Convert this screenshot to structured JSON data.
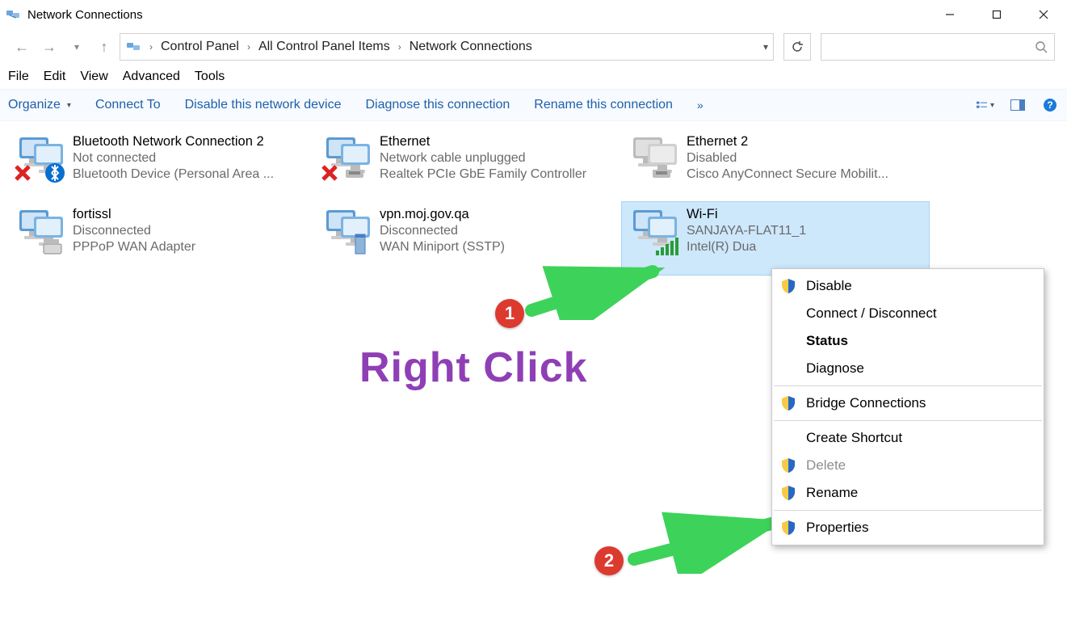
{
  "window": {
    "title": "Network Connections"
  },
  "breadcrumb": {
    "segments": [
      "Control Panel",
      "All Control Panel Items",
      "Network Connections"
    ]
  },
  "menu": {
    "items": [
      "File",
      "Edit",
      "View",
      "Advanced",
      "Tools"
    ]
  },
  "command_bar": {
    "organize": "Organize",
    "actions": [
      "Connect To",
      "Disable this network device",
      "Diagnose this connection",
      "Rename this connection"
    ],
    "overflow": "»"
  },
  "connections": [
    {
      "name": "Bluetooth Network Connection 2",
      "status": "Not connected",
      "device": "Bluetooth Device (Personal Area ...",
      "state": "error",
      "selected": false
    },
    {
      "name": "Ethernet",
      "status": "Network cable unplugged",
      "device": "Realtek PCIe GbE Family Controller",
      "state": "error",
      "selected": false
    },
    {
      "name": "Ethernet 2",
      "status": "Disabled",
      "device": "Cisco AnyConnect Secure Mobilit...",
      "state": "disabled",
      "selected": false
    },
    {
      "name": "fortissl",
      "status": "Disconnected",
      "device": "PPPoP WAN Adapter",
      "state": "dialup",
      "selected": false
    },
    {
      "name": "vpn.moj.gov.qa",
      "status": "Disconnected",
      "device": "WAN Miniport (SSTP)",
      "state": "vpn",
      "selected": false
    },
    {
      "name": "Wi-Fi",
      "status": "SANJAYA-FLAT11_1",
      "device": "Intel(R) Dua",
      "state": "wifi",
      "selected": true
    }
  ],
  "context_menu": {
    "items": [
      {
        "label": "Disable",
        "shield": true,
        "bold": false,
        "disabled": false
      },
      {
        "label": "Connect / Disconnect",
        "shield": false,
        "bold": false,
        "disabled": false
      },
      {
        "label": "Status",
        "shield": false,
        "bold": true,
        "disabled": false
      },
      {
        "label": "Diagnose",
        "shield": false,
        "bold": false,
        "disabled": false
      },
      {
        "sep": true
      },
      {
        "label": "Bridge Connections",
        "shield": true,
        "bold": false,
        "disabled": false
      },
      {
        "sep": true
      },
      {
        "label": "Create Shortcut",
        "shield": false,
        "bold": false,
        "disabled": false
      },
      {
        "label": "Delete",
        "shield": true,
        "bold": false,
        "disabled": true
      },
      {
        "label": "Rename",
        "shield": true,
        "bold": false,
        "disabled": false
      },
      {
        "sep": true
      },
      {
        "label": "Properties",
        "shield": true,
        "bold": false,
        "disabled": false
      }
    ]
  },
  "annotation": {
    "text": "Right Click",
    "badges": [
      "1",
      "2"
    ]
  }
}
